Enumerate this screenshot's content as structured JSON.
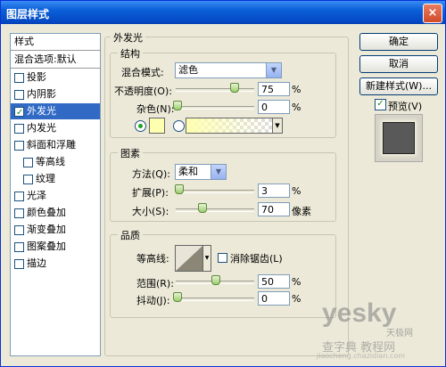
{
  "window": {
    "title": "图层样式",
    "close_label": "×"
  },
  "sidebar": {
    "items": [
      {
        "label": "样式"
      },
      {
        "label": "混合选项:默认"
      },
      {
        "label": "投影",
        "checked": false
      },
      {
        "label": "内阴影",
        "checked": false
      },
      {
        "label": "外发光",
        "checked": true
      },
      {
        "label": "内发光",
        "checked": false
      },
      {
        "label": "斜面和浮雕",
        "checked": false
      },
      {
        "label": "等高线",
        "checked": false
      },
      {
        "label": "纹理",
        "checked": false
      },
      {
        "label": "光泽",
        "checked": false
      },
      {
        "label": "颜色叠加",
        "checked": false
      },
      {
        "label": "渐变叠加",
        "checked": false
      },
      {
        "label": "图案叠加",
        "checked": false
      },
      {
        "label": "描边",
        "checked": false
      }
    ]
  },
  "outer_glow": {
    "title": "外发光",
    "structure": {
      "title": "结构",
      "blend_mode_label": "混合模式:",
      "blend_mode_value": "滤色",
      "opacity_label": "不透明度(O):",
      "opacity_value": "75",
      "opacity_unit": "%",
      "noise_label": "杂色(N):",
      "noise_value": "0",
      "noise_unit": "%"
    },
    "elements": {
      "title": "图素",
      "method_label": "方法(Q):",
      "method_value": "柔和",
      "spread_label": "扩展(P):",
      "spread_value": "3",
      "spread_unit": "%",
      "size_label": "大小(S):",
      "size_value": "70",
      "size_unit": "像素"
    },
    "quality": {
      "title": "品质",
      "contour_label": "等高线:",
      "antialias_label": "消除锯齿(L)",
      "range_label": "范围(R):",
      "range_value": "50",
      "range_unit": "%",
      "jitter_label": "抖动(J):",
      "jitter_value": "0",
      "jitter_unit": "%"
    }
  },
  "buttons": {
    "ok": "确定",
    "cancel": "取消",
    "new_style": "新建样式(W)...",
    "preview_label": "预览(V)"
  },
  "watermark": {
    "brand": "yesky",
    "sub": "天极网",
    "site": "jiaocheng.chazidian.com",
    "label": "查字典 教程网"
  },
  "colors": {
    "glow_color": "#ffffb0",
    "selection": "#316ac5"
  }
}
